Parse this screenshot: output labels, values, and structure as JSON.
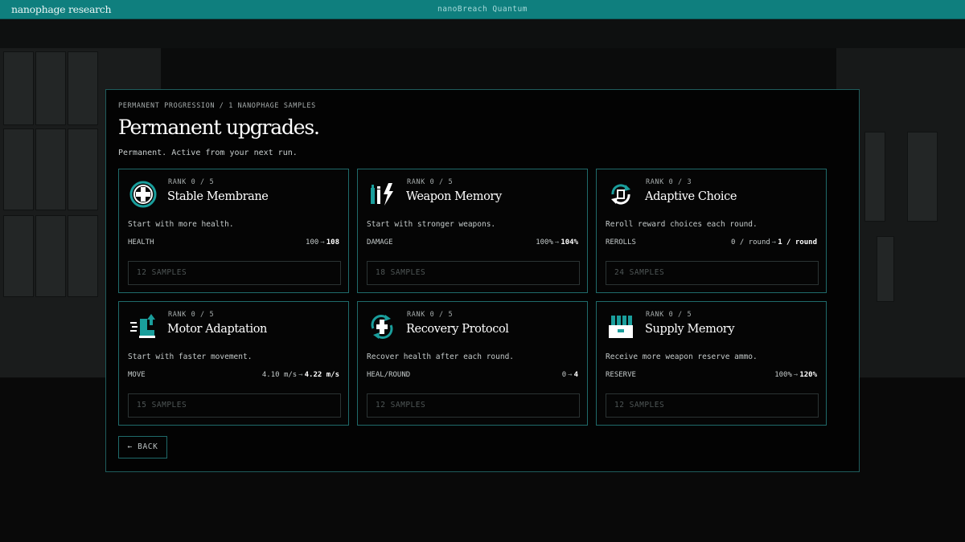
{
  "brand": "nanophage research",
  "app_title": "nanoBreach Quantum",
  "breadcrumb": "PERMANENT PROGRESSION / 1 NANOPHAGE SAMPLES",
  "title": "Permanent upgrades.",
  "subtitle": "Permanent. Active from your next run.",
  "colors": {
    "accent": "#0f7f7e",
    "border": "#1f6a6a",
    "background": "#030303"
  },
  "upgrades": [
    {
      "icon": "medical-cross-icon",
      "rank": "RANK 0 / 5",
      "name": "Stable Membrane",
      "desc": "Start with more health.",
      "stat": "HEALTH",
      "from": "100",
      "to": "108",
      "cost": "12 SAMPLES"
    },
    {
      "icon": "weapon-memory-icon",
      "rank": "RANK 0 / 5",
      "name": "Weapon Memory",
      "desc": "Start with stronger weapons.",
      "stat": "DAMAGE",
      "from": "100%",
      "to": "104%",
      "cost": "18 SAMPLES"
    },
    {
      "icon": "reroll-icon",
      "rank": "RANK 0 / 3",
      "name": "Adaptive Choice",
      "desc": "Reroll reward choices each round.",
      "stat": "REROLLS",
      "from": "0 / round",
      "to": "1 / round",
      "cost": "24 SAMPLES"
    },
    {
      "icon": "boot-speed-icon",
      "rank": "RANK 0 / 5",
      "name": "Motor Adaptation",
      "desc": "Start with faster movement.",
      "stat": "MOVE",
      "from": "4.10 m/s",
      "to": "4.22 m/s",
      "cost": "15 SAMPLES"
    },
    {
      "icon": "recovery-icon",
      "rank": "RANK 0 / 5",
      "name": "Recovery Protocol",
      "desc": "Recover health after each round.",
      "stat": "HEAL/ROUND",
      "from": "0",
      "to": "4",
      "cost": "12 SAMPLES"
    },
    {
      "icon": "ammo-crate-icon",
      "rank": "RANK 0 / 5",
      "name": "Supply Memory",
      "desc": "Receive more weapon reserve ammo.",
      "stat": "RESERVE",
      "from": "100%",
      "to": "120%",
      "cost": "12 SAMPLES"
    }
  ],
  "arrow_glyph": "→",
  "back_label": "← BACK"
}
